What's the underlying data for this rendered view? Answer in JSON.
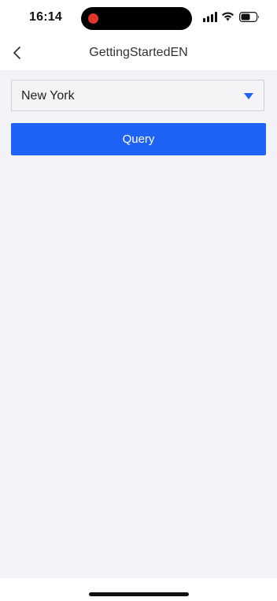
{
  "status_bar": {
    "time": "16:14",
    "icons": [
      "recording-indicator",
      "cellular-signal-icon",
      "wifi-icon",
      "battery-icon"
    ]
  },
  "nav": {
    "title": "GettingStartedEN",
    "back_icon": "chevron-left-icon"
  },
  "form": {
    "city_select": {
      "value": "New York",
      "icon": "caret-down-icon"
    },
    "query_button_label": "Query"
  },
  "colors": {
    "accent": "#1e63f5",
    "background": "#f2f2f7",
    "recording": "#e5342b"
  }
}
